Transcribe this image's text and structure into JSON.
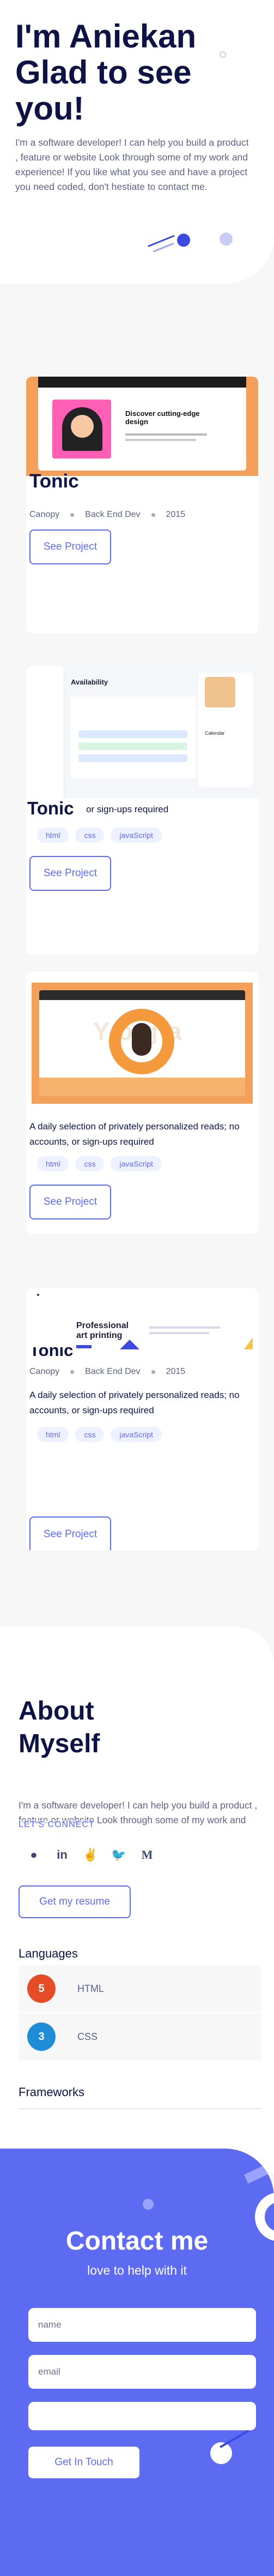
{
  "hero": {
    "title": "I'm Aniekan Glad to see you!",
    "intro": "I'm a software developer! I can help you build a product , feature or website Look through some of my work and experience! If you like what you see and have a project you need coded, don't hestiate to contact me."
  },
  "projects": [
    {
      "title": "Tonic",
      "client": "Canopy",
      "role": "Back End Dev",
      "year": "2015",
      "description": "",
      "tags": [],
      "button": "See Project",
      "screenshot_text": {
        "heading": "Discover cutting-edge design"
      }
    },
    {
      "title": "Tonic",
      "subtitle_fragment": "or sign-ups required",
      "client": "",
      "role": "",
      "year": "",
      "description": "",
      "tags": [
        "html",
        "css",
        "javaScript"
      ],
      "button": "See Project",
      "screenshot_text": {
        "heading": "Availability",
        "side_heading": "Calendar"
      }
    },
    {
      "title": "",
      "client": "",
      "role": "",
      "year": "",
      "description": "A daily selection of privately personalized reads; no accounts, or sign-ups required",
      "tags": [
        "html",
        "css",
        "javaScript"
      ],
      "button": "See Project",
      "screenshot_text": {
        "heading": "Yoga"
      }
    },
    {
      "title": "Tonic",
      "client": "Canopy",
      "role": "Back End Dev",
      "year": "2015",
      "description": "A daily selection of privately personalized reads; no accounts, or sign-ups required",
      "tags": [
        "html",
        "css",
        "javaScript"
      ],
      "button": "See Project",
      "screenshot_text": {
        "heading": "Professional art printing"
      }
    }
  ],
  "about": {
    "title": "About Myself",
    "text": "I'm a software developer! I can help you build a product , feature or website Look through some of my work and experience!",
    "connect": "LET'S CONNECT",
    "socials": [
      "github-icon",
      "linkedin-icon",
      "angellist-icon",
      "twitter-icon",
      "medium-icon"
    ],
    "resume_button": "Get my resume",
    "languages_heading": "Languages",
    "languages": [
      "HTML",
      "CSS"
    ],
    "frameworks_heading": "Frameworks"
  },
  "contact": {
    "title": "Contact me",
    "subtitle": "love to help with it",
    "name_placeholder": "name",
    "email_placeholder": "email",
    "message_placeholder": "",
    "submit": "Get In Touch"
  },
  "colors": {
    "accent": "#5c6bf2",
    "navy": "#0d1344",
    "orange": "#f5a05a",
    "muted": "#5d6185"
  }
}
